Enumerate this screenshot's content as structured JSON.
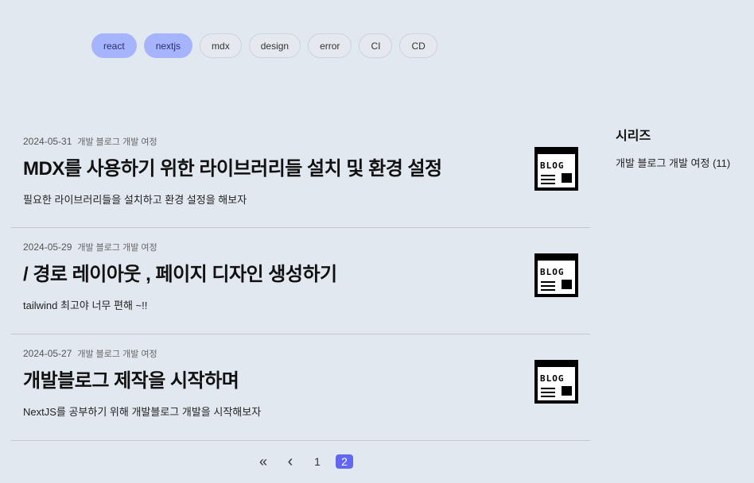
{
  "tags": [
    "react",
    "nextjs",
    "mdx",
    "design",
    "error",
    "CI",
    "CD"
  ],
  "active_tags": [
    "react",
    "nextjs"
  ],
  "posts": [
    {
      "date": "2024-05-31",
      "series": "개발 블로그 개발 여정",
      "title": "MDX를 사용하기 위한 라이브러리들 설치 및 환경 설정",
      "description": "필요한 라이브러리들을 설치하고 환경 설정을 해보자",
      "thumb_text": "BLOG"
    },
    {
      "date": "2024-05-29",
      "series": "개발 블로그 개발 여정",
      "title": "/ 경로 레이아웃 , 페이지 디자인 생성하기",
      "description": "tailwind 최고야 너무 편해 ~!!",
      "thumb_text": "BLOG"
    },
    {
      "date": "2024-05-27",
      "series": "개발 블로그 개발 여정",
      "title": "개발블로그 제작을 시작하며",
      "description": "NextJS를 공부하기 위해 개발블로그 개발을 시작해보자",
      "thumb_text": "BLOG"
    }
  ],
  "pagination": {
    "first_icon": "«",
    "prev_icon": "‹",
    "pages": [
      "1",
      "2"
    ],
    "current": "2"
  },
  "sidebar": {
    "heading": "시리즈",
    "items": [
      "개발 블로그 개발 여정 (11)"
    ]
  },
  "colors": {
    "background": "#e2e8f0",
    "active_tag": "#a5b4fc",
    "current_page": "#6366f1"
  }
}
